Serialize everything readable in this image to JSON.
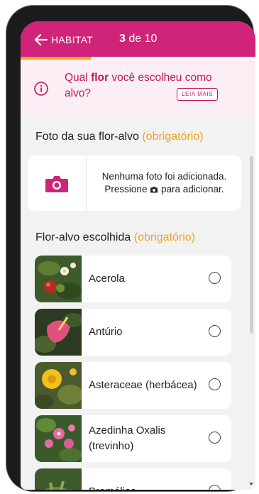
{
  "appbar": {
    "back_label": "HABITAT",
    "counter_current": "3",
    "counter_rest": " de 10",
    "progress_fraction": 0.3,
    "color": "#d0237a",
    "progress_color": "#f2a51f"
  },
  "tip": {
    "text_before": "Qual ",
    "text_bold": "flor",
    "text_after": " você escolheu como alvo?",
    "read_more": "LEIA MAIS",
    "icon": "info-icon"
  },
  "photo_section": {
    "title": "Foto da sua flor-alvo",
    "required": "(obrigatório)",
    "line1": "Nenhuma foto foi adicionada.",
    "line2_before": "Pressione",
    "line2_after": "para adicionar.",
    "icon": "camera-icon"
  },
  "flower_section": {
    "title": "Flor-alvo escolhida",
    "required": "(obrigatório)",
    "items": [
      {
        "label": "Acerola"
      },
      {
        "label": "Antúrio"
      },
      {
        "label": "Asteraceae (herbácea)"
      },
      {
        "label": "Azedinha Oxalis (trevinho)"
      },
      {
        "label": "Bromélias"
      }
    ]
  }
}
